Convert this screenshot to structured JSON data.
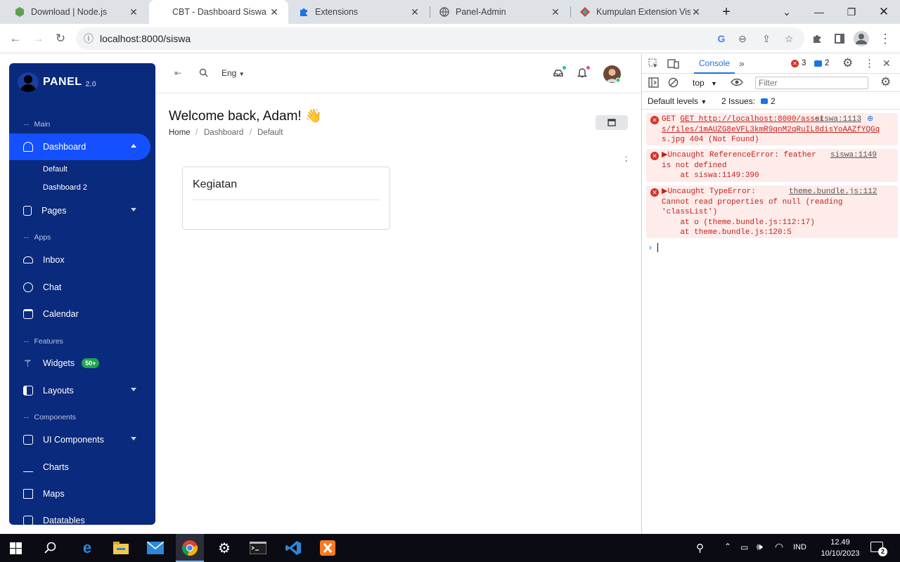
{
  "browser": {
    "tabs": [
      {
        "title": "Download | Node.js",
        "icon": "nodejs-icon"
      },
      {
        "title": "CBT - Dashboard Siswa",
        "icon": "none"
      },
      {
        "title": "Extensions",
        "icon": "puzzle-icon"
      },
      {
        "title": "Panel-Admin",
        "icon": "globe-icon"
      },
      {
        "title": "Kumpulan Extension Visu",
        "icon": "extension-site-icon"
      }
    ],
    "active_tab": 1,
    "url": "localhost:8000/siswa"
  },
  "sidebar": {
    "brand": "PANEL",
    "version": "2.0",
    "sections": {
      "main": "Main",
      "apps": "Apps",
      "features": "Features",
      "components": "Components"
    },
    "items": {
      "dashboard": "Dashboard",
      "default": "Default",
      "dashboard2": "Dashboard 2",
      "pages": "Pages",
      "inbox": "Inbox",
      "chat": "Chat",
      "calendar": "Calendar",
      "widgets": "Widgets",
      "widgets_badge": "50+",
      "layouts": "Layouts",
      "ui_components": "UI Components",
      "charts": "Charts",
      "maps": "Maps",
      "datatables": "Datatables"
    }
  },
  "header": {
    "language": "Eng"
  },
  "page": {
    "welcome": "Welcome back, Adam! 👋",
    "breadcrumb": [
      "Home",
      "Dashboard",
      "Default"
    ],
    "card_title": "Kegiatan"
  },
  "devtools": {
    "tab": "Console",
    "error_count": "3",
    "message_count": "2",
    "context": "top",
    "filter_placeholder": "Filter",
    "levels": "Default levels",
    "issues": "2 Issues:",
    "issues_count": "2",
    "errors": [
      {
        "line1": "GET http://localhost:8000/asset",
        "source": "siswa:1113",
        "line2": "s/files/1mAUZG8eVFL3kmR9qnM2qRuIL8disYoAAZfYQGq",
        "line3": "s.jpg 404 (Not Found)"
      },
      {
        "line1": "▶Uncaught ReferenceError: feather",
        "source": "siswa:1149",
        "line2": "is not defined",
        "line3": "    at siswa:1149:390"
      },
      {
        "line1": "▶Uncaught TypeError:",
        "source": "theme.bundle.js:112",
        "line2": "Cannot read properties of null (reading",
        "line3": "'classList')",
        "line4": "    at o (theme.bundle.js:112:17)",
        "line5": "    at theme.bundle.js:120:5"
      }
    ]
  },
  "taskbar": {
    "language": "IND",
    "time": "12.49",
    "date": "10/10/2023",
    "notifications": "2"
  }
}
